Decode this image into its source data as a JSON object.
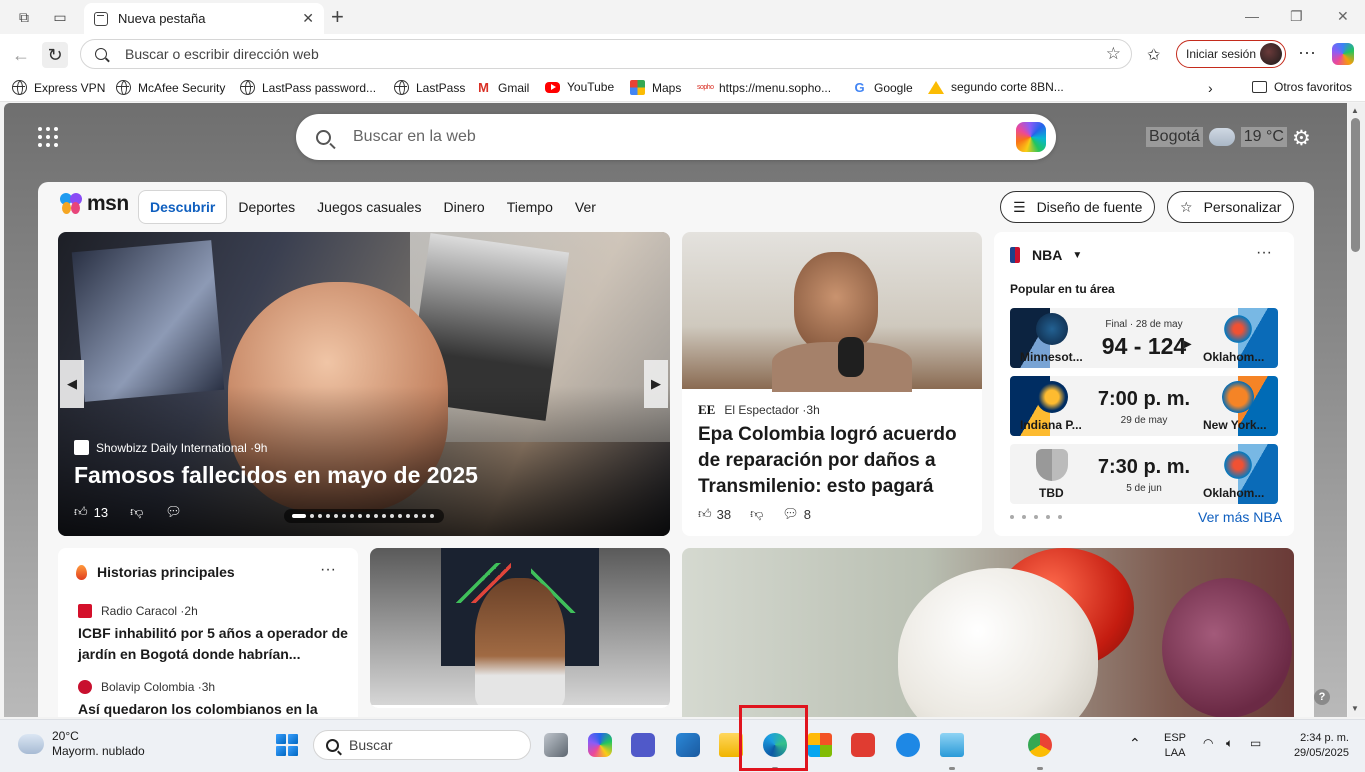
{
  "browser": {
    "tab_title": "Nueva pestaña",
    "address_placeholder": "Buscar o escribir dirección web",
    "signin_label": "Iniciar sesión",
    "favorites": [
      {
        "label": "Express VPN",
        "icon": "globe-icon"
      },
      {
        "label": "McAfee Security",
        "icon": "globe-icon"
      },
      {
        "label": "LastPass password...",
        "icon": "globe-icon"
      },
      {
        "label": "LastPass",
        "icon": "globe-icon"
      },
      {
        "label": "Gmail",
        "icon": "gmail-icon"
      },
      {
        "label": "YouTube",
        "icon": "youtube-icon"
      },
      {
        "label": "Maps",
        "icon": "maps-icon"
      },
      {
        "label": "https://menu.sopho...",
        "icon": "sophos-icon"
      },
      {
        "label": "Google",
        "icon": "google-icon"
      },
      {
        "label": "segundo corte 8BN...",
        "icon": "drive-icon"
      }
    ],
    "other_favorites": "Otros favoritos"
  },
  "newtab": {
    "search_placeholder": "Buscar en la web",
    "city": "Bogotá",
    "temp": "19 °C"
  },
  "msn": {
    "brand": "msn",
    "nav": [
      "Descubrir",
      "Deportes",
      "Juegos casuales",
      "Dinero",
      "Tiempo",
      "Ver"
    ],
    "font_design_label": "Diseño de fuente",
    "personalize_label": "Personalizar",
    "hero": {
      "source": "Showbizz Daily International",
      "age": "9h",
      "title": "Famosos fallecidos en mayo de 2025",
      "likes": "13"
    },
    "story2": {
      "source_logo": "EE",
      "source": "El Espectador",
      "age": "3h",
      "title": "Epa Colombia logró acuerdo de reparación por daños a Transmilenio: esto pagará",
      "likes": "38",
      "comments": "8"
    },
    "nba": {
      "title": "NBA",
      "subtitle": "Popular en tu área",
      "link": "Ver más NBA",
      "games": [
        {
          "meta": "Final · 28 de may",
          "score": "94 - 124",
          "home": "Minnesot...",
          "away": "Oklahom...",
          "date": ""
        },
        {
          "meta": "",
          "score": "7:00 p. m.",
          "home": "Indiana P...",
          "away": "New York...",
          "date": "29 de may"
        },
        {
          "meta": "",
          "score": "7:30 p. m.",
          "home": "TBD",
          "away": "Oklahom...",
          "date": "5 de jun"
        }
      ]
    },
    "top_stories": {
      "title": "Historias principales",
      "items": [
        {
          "source": "Radio Caracol",
          "age": "2h",
          "title": "ICBF inhabilitó por 5 años a operador de jardín en Bogotá donde habrían..."
        },
        {
          "source": "Bolavip Colombia",
          "age": "3h",
          "title": "Así quedaron los colombianos en la"
        }
      ]
    }
  },
  "taskbar": {
    "weather_temp": "20°C",
    "weather_desc": "Mayorm. nublado",
    "search_placeholder": "Buscar",
    "lang_top": "ESP",
    "lang_bottom": "LAA",
    "time": "2:34 p. m.",
    "date": "29/05/2025"
  },
  "colors": {
    "accent": "#0f5fbf",
    "signin_border": "#c42b1c",
    "highlight": "#e0141e"
  }
}
